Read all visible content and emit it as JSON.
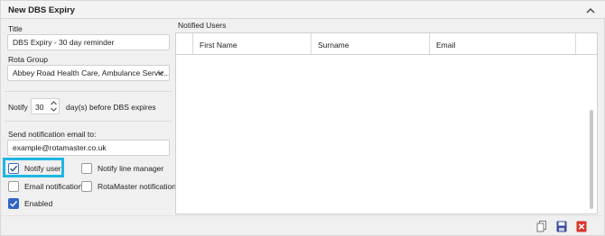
{
  "panel": {
    "title": "New DBS Expiry"
  },
  "form": {
    "title_label": "Title",
    "title_value": "DBS Expiry - 30 day reminder",
    "rota_group_label": "Rota Group",
    "rota_group_value": "Abbey Road Health Care, Ambulance Servic...",
    "notify_prefix": "Notify",
    "notify_days": "30",
    "notify_suffix": "day(s) before DBS expires",
    "email_label": "Send notification email to:",
    "email_value": "example@rotamaster.co.uk",
    "checkboxes": {
      "notify_user": {
        "label": "Notify user",
        "checked": true
      },
      "notify_line_manager": {
        "label": "Notify line manager",
        "checked": false
      },
      "email_notification": {
        "label": "Email notification",
        "checked": false
      },
      "rotamaster_notification": {
        "label": "RotaMaster notification",
        "checked": false
      },
      "enabled": {
        "label": "Enabled",
        "checked": true
      }
    }
  },
  "notified_users": {
    "title": "Notified Users",
    "columns": [
      "First Name",
      "Surname",
      "Email"
    ],
    "rows": []
  },
  "colors": {
    "highlight": "#1fb7e3",
    "checkbox_blue": "#2f63c6",
    "delete_red": "#d9352b",
    "save_blue": "#3b4e9c"
  },
  "footer": {
    "icons": [
      "copy-icon",
      "save-icon",
      "delete-icon"
    ]
  }
}
